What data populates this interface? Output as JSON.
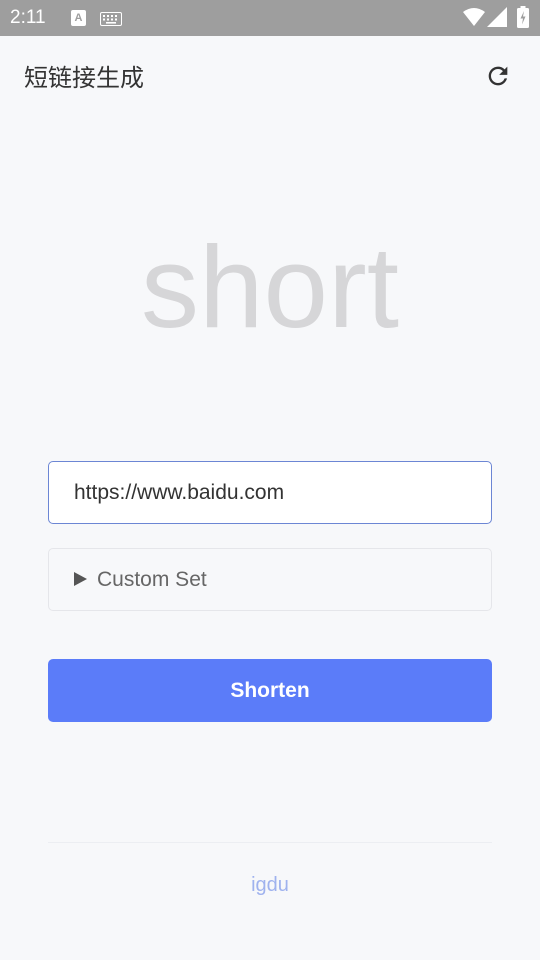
{
  "status_bar": {
    "time": "2:11",
    "a_badge": "A",
    "icons": [
      "a-notification-icon",
      "keyboard-icon",
      "wifi-icon",
      "signal-icon",
      "battery-icon"
    ]
  },
  "app_bar": {
    "title": "短链接生成",
    "refresh_icon": "refresh-icon"
  },
  "hero": {
    "text": "short"
  },
  "form": {
    "url_value": "https://www.baidu.com",
    "custom_set_label": "Custom Set",
    "shorten_label": "Shorten"
  },
  "footer": {
    "link_text": "igdu"
  },
  "colors": {
    "background": "#f7f8fa",
    "status_bar": "#9e9e9e",
    "primary": "#5b7cf9",
    "input_border": "#6c86d4",
    "hero_text": "#d6d6d8",
    "footer_link": "#9fb2ee"
  }
}
